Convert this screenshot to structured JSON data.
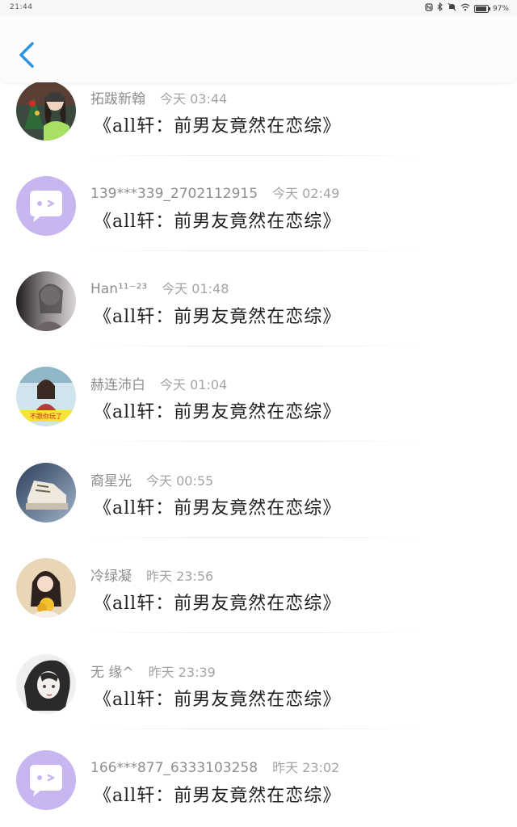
{
  "status_bar": {
    "time": "21:44",
    "battery": "97%",
    "icons": [
      "nfc-icon",
      "bluetooth-icon",
      "mute-icon",
      "wifi-icon",
      "battery-icon"
    ]
  },
  "header": {
    "back_icon": "chevron-left-icon",
    "accent_color": "#2a95e6"
  },
  "comments": [
    {
      "username": "拓跋新翰",
      "time": "今天 03:44",
      "message": "《all轩：前男友竟然在恋综》",
      "avatar": "photo-christmas"
    },
    {
      "username": "139***339_2702112915",
      "time": "今天 02:49",
      "message": "《all轩：前男友竟然在恋综》",
      "avatar": "default-chat-bubble"
    },
    {
      "username": "Han¹¹⁻²³",
      "time": "今天 01:48",
      "message": "《all轩：前男友竟然在恋综》",
      "avatar": "photo-gray-girl"
    },
    {
      "username": "赫连沛白",
      "time": "今天 01:04",
      "message": "《all轩：前男友竟然在恋综》",
      "avatar": "photo-meme-girl"
    },
    {
      "username": "裔星光",
      "time": "今天 00:55",
      "message": "《all轩：前男友竟然在恋综》",
      "avatar": "photo-sneaker"
    },
    {
      "username": "冷绿凝",
      "time": "昨天 23:56",
      "message": "《all轩：前男友竟然在恋综》",
      "avatar": "photo-girl-flowers"
    },
    {
      "username": "无 缘^",
      "time": "昨天 23:39",
      "message": "《all轩：前男友竟然在恋综》",
      "avatar": "photo-anime-sketch"
    },
    {
      "username": "166***877_6333103258",
      "time": "昨天 23:02",
      "message": "《all轩：前男友竟然在恋综》",
      "avatar": "default-chat-bubble"
    }
  ]
}
